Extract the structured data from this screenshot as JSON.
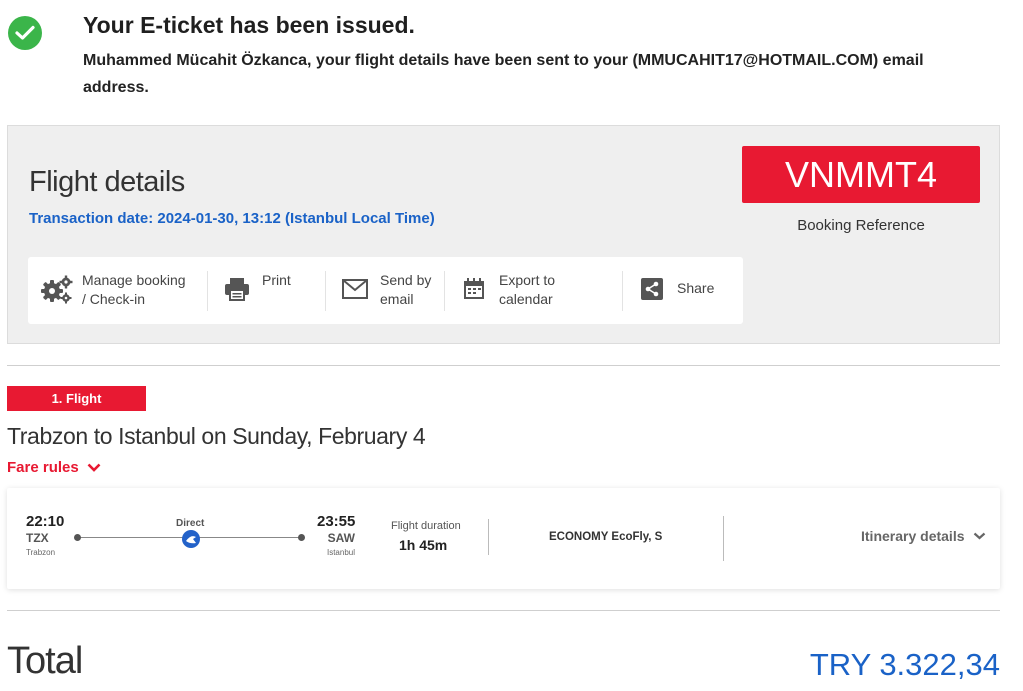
{
  "confirmation": {
    "title": "Your E-ticket has been issued.",
    "message": "Muhammed Mücahit Özkanca, your flight details have been sent to your (MMUCAHIT17@HOTMAIL.COM) email address."
  },
  "flight_details": {
    "title": "Flight details",
    "transaction_date": "Transaction date: 2024-01-30, 13:12 (Istanbul Local Time)",
    "booking_reference": "VNMMT4",
    "booking_reference_label": "Booking Reference",
    "actions": [
      {
        "label": "Manage booking\n/ Check-in",
        "icon": "gears-icon"
      },
      {
        "label": "Print",
        "icon": "printer-icon"
      },
      {
        "label": "Send by\nemail",
        "icon": "envelope-icon"
      },
      {
        "label": "Export to\ncalendar",
        "icon": "calendar-icon"
      },
      {
        "label": "Share",
        "icon": "share-icon"
      }
    ]
  },
  "flight": {
    "tag": "1. Flight",
    "route_title": "Trabzon to Istanbul on Sunday, February 4",
    "fare_rules": "Fare rules",
    "departure": {
      "time": "22:10",
      "code": "TZX",
      "city": "Trabzon"
    },
    "arrival": {
      "time": "23:55",
      "code": "SAW",
      "city": "Istanbul"
    },
    "stop_type": "Direct",
    "duration_label": "Flight duration",
    "duration": "1h 45m",
    "cabin": "ECONOMY EcoFly, S",
    "itinerary_details": "Itinerary details"
  },
  "total": {
    "label": "Total",
    "amount": "TRY 3.322,34"
  },
  "colors": {
    "accent_red": "#e81932",
    "link_blue": "#1a62c7",
    "success_green": "#3bb54a"
  }
}
